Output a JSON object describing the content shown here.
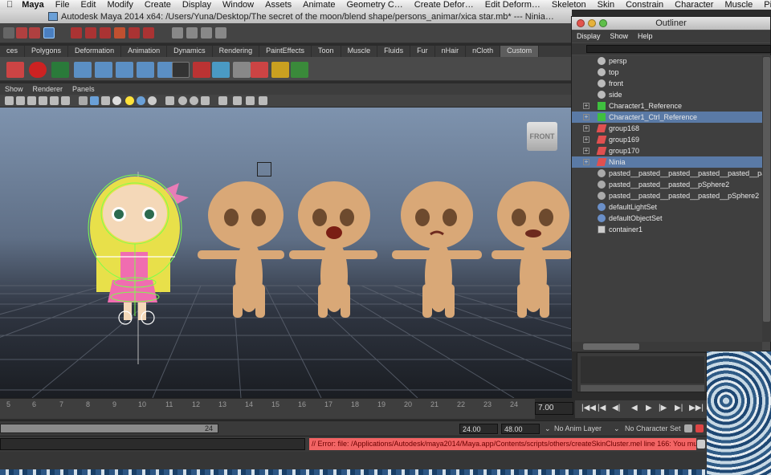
{
  "menubar": {
    "apple": "",
    "items": [
      "Maya",
      "File",
      "Edit",
      "Modify",
      "Create",
      "Display",
      "Window",
      "Assets",
      "Animate",
      "Geometry C…",
      "Create Defor…",
      "Edit Deform…",
      "Skeleton",
      "Skin",
      "Constrain",
      "Character",
      "Muscle",
      "Pipeline Cach"
    ]
  },
  "window_title": "Autodesk Maya 2014 x64: /Users/Yuna/Desktop/The secret of the moon/blend shape/persons_animar/xica star.mb*   ---   Ninia…",
  "shelf_tabs": [
    "ces",
    "Polygons",
    "Deformation",
    "Animation",
    "Dynamics",
    "Rendering",
    "PaintEffects",
    "Toon",
    "Muscle",
    "Fluids",
    "Fur",
    "nHair",
    "nCloth",
    "Custom"
  ],
  "shelf_selected": "Custom",
  "panel_menu": [
    "Show",
    "Renderer",
    "Panels"
  ],
  "viewcube_label": "FRONT",
  "timeline": {
    "ticks": [
      "5",
      "6",
      "7",
      "8",
      "9",
      "10",
      "11",
      "12",
      "13",
      "14",
      "15",
      "16",
      "17",
      "18",
      "19",
      "20",
      "21",
      "22",
      "23",
      "24"
    ],
    "current_time": "7.00"
  },
  "playback": {
    "buttons": [
      "go-start",
      "step-back-key",
      "step-back",
      "play-back",
      "play-forward",
      "step-forward",
      "step-forward-key",
      "go-end"
    ]
  },
  "range": {
    "end_on_slider": "24",
    "range_end": "24.00",
    "anim_end": "48.00",
    "anim_layer": "No Anim Layer",
    "character_set": "No Character Set"
  },
  "command": {
    "error_text": "// Error: file: /Applications/Autodesk/maya2014/Maya.app/Contents/scripts/others/createSkinCluster.mel line 166: You mus"
  },
  "outliner": {
    "title": "Outliner",
    "menu": [
      "Display",
      "Show",
      "Help"
    ],
    "items": [
      {
        "label": "persp",
        "icon": "camera-icon",
        "expandable": false,
        "selected": false
      },
      {
        "label": "top",
        "icon": "camera-icon",
        "expandable": false,
        "selected": false
      },
      {
        "label": "front",
        "icon": "camera-icon",
        "expandable": false,
        "selected": false
      },
      {
        "label": "side",
        "icon": "camera-icon",
        "expandable": false,
        "selected": false
      },
      {
        "label": "Character1_Reference",
        "icon": "joint-icon",
        "expandable": true,
        "selected": false
      },
      {
        "label": "Character1_Ctrl_Reference",
        "icon": "joint-icon",
        "expandable": true,
        "selected": true
      },
      {
        "label": "group168",
        "icon": "transform-icon",
        "expandable": true,
        "selected": false
      },
      {
        "label": "group169",
        "icon": "transform-icon",
        "expandable": true,
        "selected": false
      },
      {
        "label": "group170",
        "icon": "transform-icon",
        "expandable": true,
        "selected": false
      },
      {
        "label": "Ninia",
        "icon": "transform-icon",
        "expandable": true,
        "selected": true
      },
      {
        "label": "pasted__pasted__pasted__pasted__pasted__pasted",
        "icon": "shape-icon",
        "expandable": false,
        "selected": false
      },
      {
        "label": "pasted__pasted__pasted__pSphere2",
        "icon": "shape-icon",
        "expandable": false,
        "selected": false
      },
      {
        "label": "pasted__pasted__pasted__pasted__pSphere2",
        "icon": "shape-icon",
        "expandable": false,
        "selected": false
      },
      {
        "label": "defaultLightSet",
        "icon": "set-icon",
        "expandable": false,
        "selected": false
      },
      {
        "label": "defaultObjectSet",
        "icon": "set-icon",
        "expandable": false,
        "selected": false
      },
      {
        "label": "container1",
        "icon": "container-icon",
        "expandable": false,
        "selected": false
      }
    ]
  },
  "colors": {
    "error_bg": "#f26464",
    "selection": "#5a7aa6",
    "skin": "#d9a877",
    "rig_green": "#7cff4a"
  }
}
